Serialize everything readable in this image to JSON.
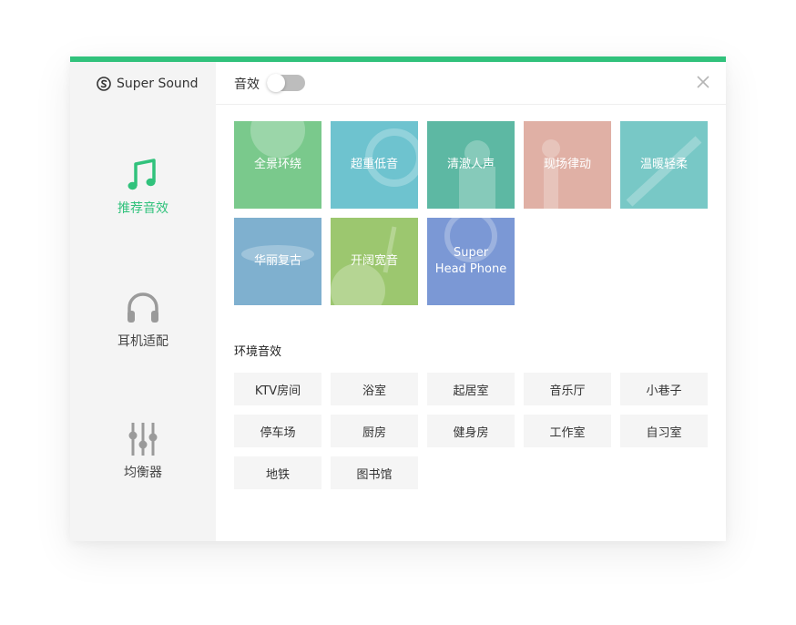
{
  "app": {
    "name": "Super Sound",
    "accent_color": "#31c27c",
    "logo_icon": "super-sound-logo-icon"
  },
  "sidebar": {
    "items": [
      {
        "label": "推荐音效",
        "icon": "music-note-icon",
        "active": true
      },
      {
        "label": "耳机适配",
        "icon": "headphones-icon",
        "active": false
      },
      {
        "label": "均衡器",
        "icon": "equalizer-icon",
        "active": false
      }
    ]
  },
  "header": {
    "title": "音效",
    "toggle_on": false,
    "close_icon": "close-icon"
  },
  "presets": [
    {
      "label": "全景环绕",
      "color": "#7ac98c"
    },
    {
      "label": "超重低音",
      "color": "#6ec3cf"
    },
    {
      "label": "清澈人声",
      "color": "#5db8a3"
    },
    {
      "label": "现场律动",
      "color": "#e0b0a5"
    },
    {
      "label": "温暖轻柔",
      "color": "#78c8c6"
    },
    {
      "label": "华丽复古",
      "color": "#7fb0cf"
    },
    {
      "label": "开阔宽音",
      "color": "#9cc76f"
    },
    {
      "label": "Super\nHead Phone",
      "color": "#7b98d5"
    }
  ],
  "environment": {
    "title": "环境音效",
    "items": [
      "KTV房间",
      "浴室",
      "起居室",
      "音乐厅",
      "小巷子",
      "停车场",
      "厨房",
      "健身房",
      "工作室",
      "自习室",
      "地铁",
      "图书馆"
    ]
  }
}
